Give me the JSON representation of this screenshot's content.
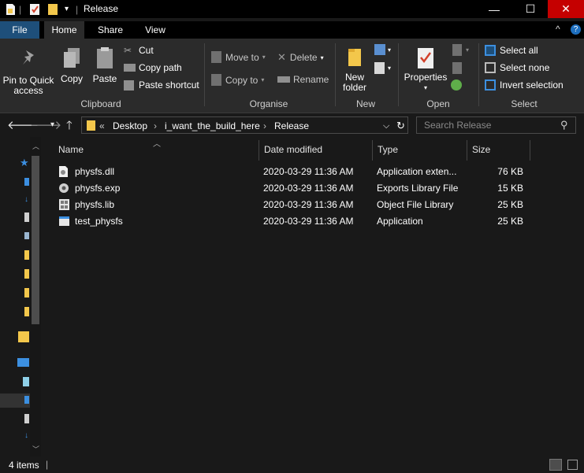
{
  "window": {
    "title": "Release",
    "minimize_glyph": "—",
    "maximize_glyph": "☐",
    "close_glyph": "✕",
    "close_color": "#c50000"
  },
  "ribbon_tabs": [
    {
      "label": "File"
    },
    {
      "label": "Home"
    },
    {
      "label": "Share"
    },
    {
      "label": "View"
    }
  ],
  "ribbon_controls": {
    "collapse": "^",
    "help": "?"
  },
  "ribbon": {
    "clipboard": {
      "pin": "Pin to Quick access",
      "copy": "Copy",
      "paste": "Paste",
      "cut": "Cut",
      "copy_path": "Copy path",
      "paste_shortcut": "Paste shortcut",
      "label": "Clipboard"
    },
    "organise": {
      "move_to": "Move to",
      "copy_to": "Copy to",
      "delete": "Delete",
      "rename": "Rename",
      "label": "Organise"
    },
    "new": {
      "new_folder": "New folder",
      "label": "New"
    },
    "open": {
      "properties": "Properties",
      "label": "Open"
    },
    "select": {
      "select_all": "Select all",
      "select_none": "Select none",
      "invert_selection": "Invert selection",
      "label": "Select"
    }
  },
  "address": {
    "overflow": "«",
    "crumbs": [
      "Desktop",
      "i_want_the_build_here",
      "Release"
    ],
    "separator": "›"
  },
  "search": {
    "placeholder": "Search Release"
  },
  "columns": {
    "name": "Name",
    "date": "Date modified",
    "type": "Type",
    "size": "Size"
  },
  "files": [
    {
      "name": "physfs.dll",
      "date": "2020-03-29 11:36 AM",
      "type": "Application exten...",
      "size": "76 KB",
      "icon": "dll-file-icon"
    },
    {
      "name": "physfs.exp",
      "date": "2020-03-29 11:36 AM",
      "type": "Exports Library File",
      "size": "15 KB",
      "icon": "exp-file-icon"
    },
    {
      "name": "physfs.lib",
      "date": "2020-03-29 11:36 AM",
      "type": "Object File Library",
      "size": "25 KB",
      "icon": "lib-file-icon"
    },
    {
      "name": "test_physfs",
      "date": "2020-03-29 11:36 AM",
      "type": "Application",
      "size": "25 KB",
      "icon": "application-icon"
    }
  ],
  "status": {
    "items": "4 items"
  },
  "colors": {
    "accent": "#1e4f7a",
    "folder": "#f3c74b",
    "ribbon_bg": "#2b2b2b",
    "window_bg": "#191919"
  }
}
